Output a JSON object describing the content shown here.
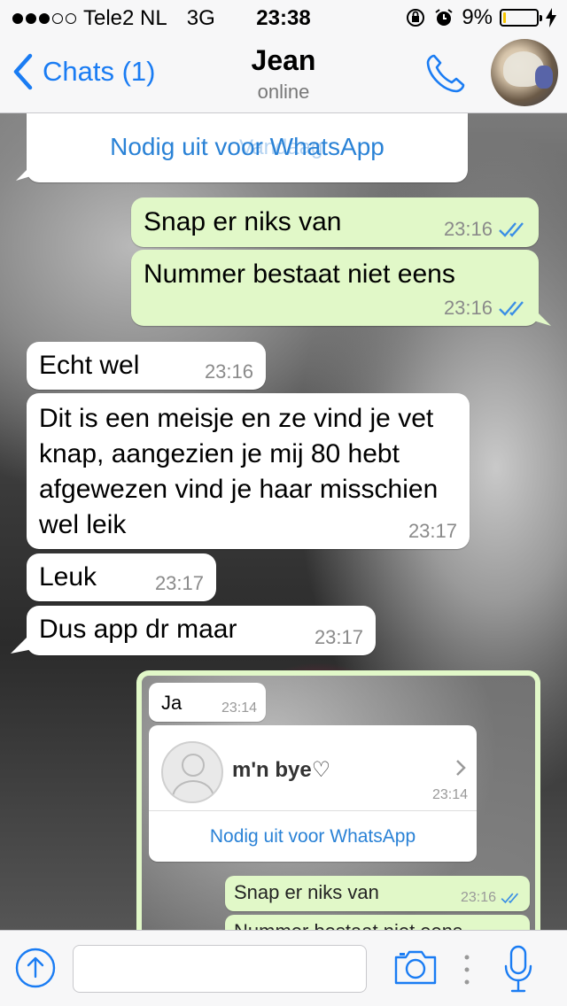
{
  "status_bar": {
    "carrier": "Tele2 NL",
    "network": "3G",
    "time": "23:38",
    "battery": "9%",
    "battery_level": 0.09,
    "signal_bars_filled": 3,
    "signal_bars_total": 5
  },
  "header": {
    "back_label": "Chats (1)",
    "contact_name": "Jean",
    "contact_status": "online"
  },
  "colors": {
    "accent": "#1a7cf3",
    "outgoing_bubble": "#e1f8c8",
    "incoming_bubble": "#ffffff",
    "read_tick": "#3b8fe5"
  },
  "invite": {
    "link_text": "Nodig uit voor WhatsApp",
    "ghost_text": "Vandaag"
  },
  "messages": [
    {
      "dir": "out",
      "text": "Snap er niks van",
      "time": "23:16",
      "read": true
    },
    {
      "dir": "out",
      "text": "Nummer bestaat niet eens",
      "time": "23:16",
      "read": true
    },
    {
      "dir": "in",
      "text": "Echt wel",
      "time": "23:16"
    },
    {
      "dir": "in",
      "text": "Dit is een meisje en ze vind je vet knap, aangezien je mij 80 hebt afgewezen vind je haar misschien wel leik",
      "time": "23:17"
    },
    {
      "dir": "in",
      "text": "Leuk",
      "time": "23:17"
    },
    {
      "dir": "in",
      "text": "Dus app dr maar",
      "time": "23:17"
    }
  ],
  "screenshot_image": {
    "msg_ja": {
      "text": "Ja",
      "time": "23:14"
    },
    "contact_card": {
      "name": "m'n bye♡",
      "time": "23:14",
      "invite": "Nodig uit voor WhatsApp"
    },
    "msg_snap": {
      "text": "Snap er niks van",
      "time": "23:16"
    },
    "msg_nummer": {
      "text": "Nummer bestaat niet eens"
    }
  },
  "input": {
    "placeholder": ""
  },
  "icons": {
    "back": "chevron-left-icon",
    "call": "phone-icon",
    "attach": "arrow-up-circle-icon",
    "camera": "camera-icon",
    "mic": "microphone-icon"
  }
}
